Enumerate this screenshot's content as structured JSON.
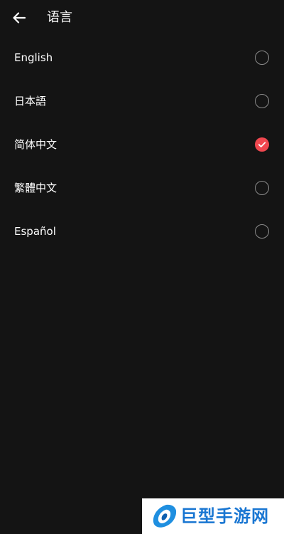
{
  "header": {
    "title": "语言"
  },
  "languages": [
    {
      "label": "English",
      "selected": false
    },
    {
      "label": "日本語",
      "selected": false
    },
    {
      "label": "简体中文",
      "selected": true
    },
    {
      "label": "繁體中文",
      "selected": false
    },
    {
      "label": "Español",
      "selected": false
    }
  ],
  "colors": {
    "background": "#141414",
    "accent": "#f0474f",
    "radio_border": "#8c8c8c",
    "watermark_blue": "#1976d2"
  },
  "icons": {
    "back": "arrow-left-icon",
    "selected": "check-circle-icon",
    "unselected": "radio-empty-icon"
  },
  "watermark": {
    "text": "巨型手游网"
  }
}
